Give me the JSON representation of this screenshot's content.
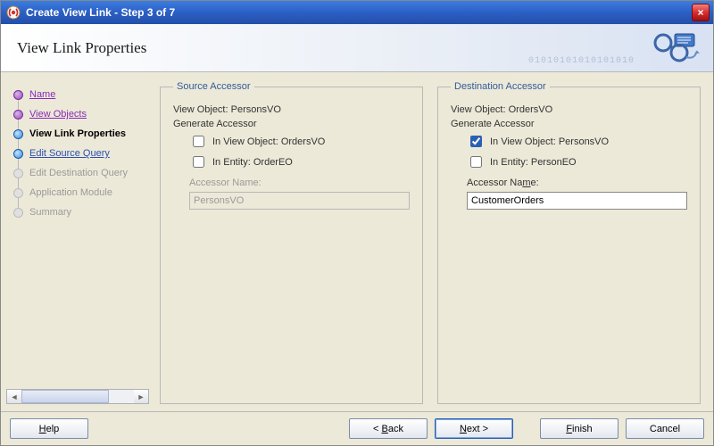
{
  "window": {
    "title": "Create View Link - Step 3 of 7",
    "close_icon_label": "×"
  },
  "page_title": "View Link Properties",
  "binary_deco": "01010101010101010",
  "steps": [
    {
      "label": "Name",
      "state": "done"
    },
    {
      "label": "View Objects",
      "state": "done"
    },
    {
      "label": "View Link Properties",
      "state": "current"
    },
    {
      "label": "Edit Source Query",
      "state": "next"
    },
    {
      "label": "Edit Destination Query",
      "state": "future"
    },
    {
      "label": "Application Module",
      "state": "future"
    },
    {
      "label": "Summary",
      "state": "future"
    }
  ],
  "source": {
    "legend": "Source Accessor",
    "view_object_label": "View Object:",
    "view_object_value": "PersonsVO",
    "generate_label": "Generate Accessor",
    "in_view_object_label": "In View Object: OrdersVO",
    "in_view_object_checked": false,
    "in_entity_label": "In Entity: OrderEO",
    "in_entity_checked": false,
    "accessor_name_label": "Accessor Name:",
    "accessor_name_value": "PersonsVO",
    "accessor_name_enabled": false
  },
  "destination": {
    "legend": "Destination Accessor",
    "view_object_label": "View Object:",
    "view_object_value": "OrdersVO",
    "generate_label": "Generate Accessor",
    "in_view_object_label": "In View Object: PersonsVO",
    "in_view_object_checked": true,
    "in_entity_label": "In Entity: PersonEO",
    "in_entity_checked": false,
    "accessor_name_label": "Accessor Name:",
    "accessor_name_value": "CustomerOrders",
    "accessor_name_enabled": true
  },
  "buttons": {
    "help": "Help",
    "back": "< Back",
    "next": "Next >",
    "finish": "Finish",
    "cancel": "Cancel"
  }
}
